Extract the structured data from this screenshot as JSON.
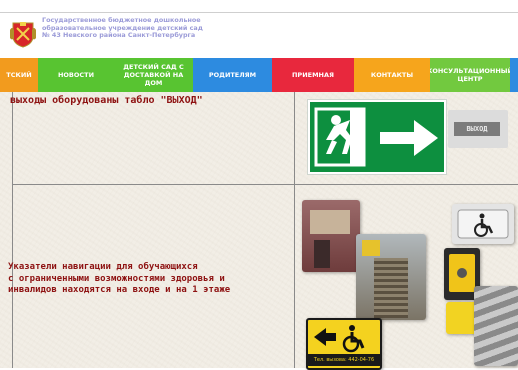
{
  "header": {
    "org_lines": [
      "Государственное бюджетное дошкольное",
      "образовательное учреждение детский сад",
      "№ 43 Невского района Санкт-Петербурга"
    ]
  },
  "nav": {
    "items": [
      {
        "label": "ТСКИЙ",
        "color": "#f29b1e"
      },
      {
        "label": "НОВОСТИ",
        "color": "#58c431"
      },
      {
        "label": "ДЕТСКИЙ САД С ДОСТАВКОЙ НА ДОМ",
        "color": "#58c431"
      },
      {
        "label": "РОДИТЕЛЯМ",
        "color": "#2d8be0"
      },
      {
        "label": "ПРИЕМНАЯ",
        "color": "#e8283d"
      },
      {
        "label": "КОНТАКТЫ",
        "color": "#f6a51c"
      },
      {
        "label": "КОНСУЛЬТАЦИОННЫЙ ЦЕНТР",
        "color": "#72c93f"
      }
    ]
  },
  "rows": {
    "r1": {
      "text": "выходы оборудованы табло \"ВЫХОД\""
    },
    "r2": {
      "lines": [
        "Указатели навигации для обучающихся",
        "с ограниченными возможностями здоровья и",
        "инвалидов находятся на входе и на 1 этаже"
      ]
    }
  },
  "images": {
    "exit_plate_text": "ВЫХОД",
    "phone_label": "Тел. вызова: 442-04-76"
  },
  "colors": {
    "text_dark_red": "#8e1212",
    "exit_green": "#0d8f3f",
    "header_text": "#9b9bd8"
  }
}
